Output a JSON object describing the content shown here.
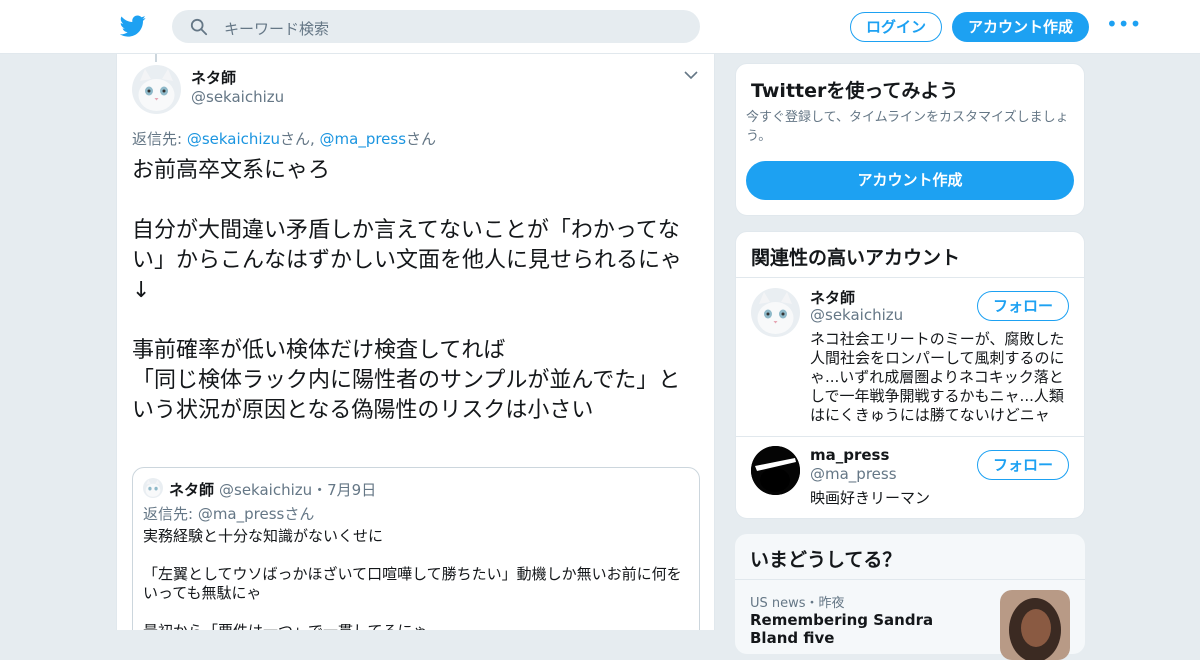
{
  "topbar": {
    "search_placeholder": "キーワード検索",
    "login_label": "ログイン",
    "signup_label": "アカウント作成",
    "more_label": "•••"
  },
  "tweet": {
    "name": "ネタ師",
    "handle": "@sekaichizu",
    "reply_prefix": "返信先: ",
    "reply_user1": "@sekaichizu",
    "reply_suffix1": "さん, ",
    "reply_user2": "@ma_press",
    "reply_suffix2": "さん",
    "text": "お前高卒文系にゃろ\n\n自分が大間違い矛盾しか言えてないことが「わかってない」からこんなはずかしい文面を他人に見せられるにゃ\n↓\n\n事前確率が低い検体だけ検査してれば\n「同じ検体ラック内に陽性者のサンプルが並んでた」という状況が原因となる偽陽性のリスクは小さい"
  },
  "quote": {
    "name": "ネタ師",
    "handle_date": "@sekaichizu・7月9日",
    "replyto": "返信先: @ma_pressさん",
    "text": "実務経験と十分な知識がないくせに\n\n「左翼としてウソばっかほざいて口喧嘩して勝ちたい」動機しか無いお前に何をいっても無駄にゃ\n\n最初から「要件は一つ」で一貫してるにゃ"
  },
  "signup_card": {
    "title": "Twitterを使ってみよう",
    "subtitle": "今すぐ登録して、タイムラインをカスタマイズしましょう。",
    "button": "アカウント作成"
  },
  "related": {
    "title": "関連性の高いアカウント",
    "accounts": [
      {
        "name": "ネタ師",
        "handle": "@sekaichizu",
        "bio": "ネコ社会エリートのミーが、腐敗した人間社会をロンパーして風刺するのにゃ...いずれ成層圏よりネコキック落としで一年戦争開戦するかもニャ...人類はにくきゅうには勝てないけどニャ",
        "follow": "フォロー"
      },
      {
        "name": "ma_press",
        "handle": "@ma_press",
        "bio": "映画好きリーマン",
        "follow": "フォロー"
      }
    ]
  },
  "trends": {
    "title": "いまどうしてる？",
    "meta": "US news・昨夜",
    "headline": "Remembering Sandra Bland five"
  },
  "colors": {
    "accent": "#1da1f2",
    "link": "#1b95e0",
    "muted": "#657786"
  }
}
